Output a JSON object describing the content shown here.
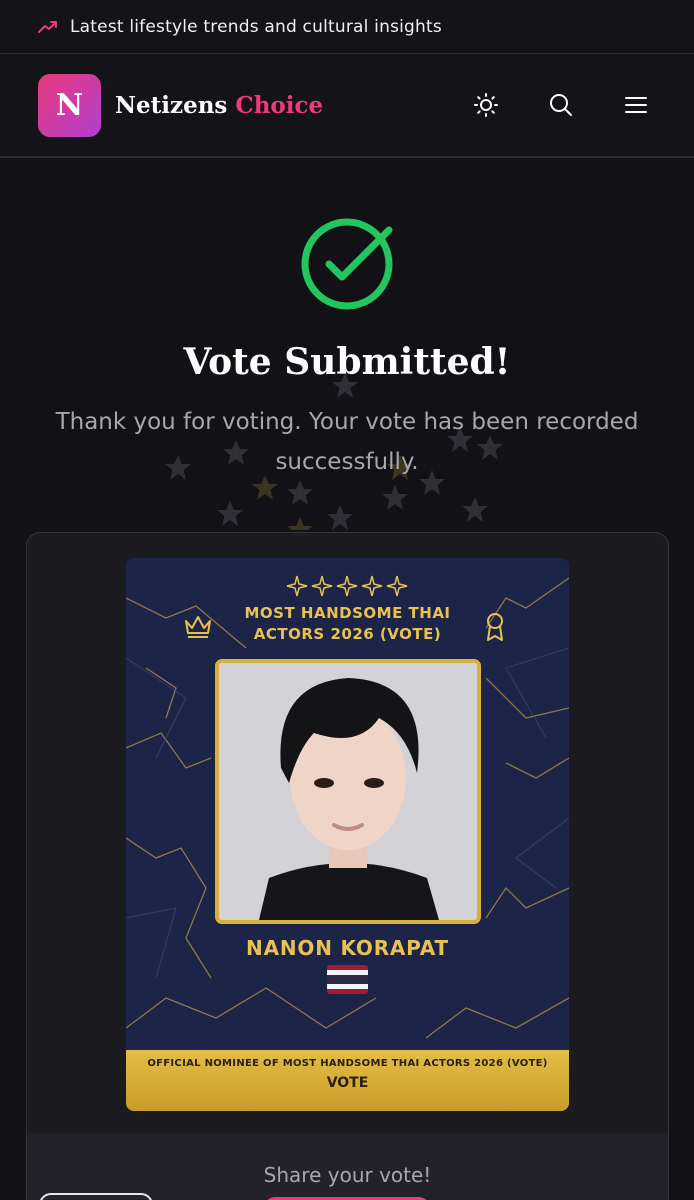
{
  "topbar": {
    "tagline": "Latest lifestyle trends and cultural insights",
    "icon": "trending-up-icon"
  },
  "header": {
    "logo_letter": "N",
    "brand_part1": "Netizens",
    "brand_part2": "Choice",
    "icons": [
      "theme-toggle-icon",
      "search-icon",
      "menu-icon"
    ]
  },
  "status": {
    "title": "Vote Submitted!",
    "message": "Thank you for voting. Your vote has been recorded successfully."
  },
  "card": {
    "title": "MOST HANDSOME THAI ACTORS 2026 (VOTE)",
    "nominee_name": "NANON KORAPAT",
    "country_flag": "thailand-flag-icon",
    "footer_line": "OFFICIAL NOMINEE OF MOST HANDSOME THAI ACTORS 2026 (VOTE)",
    "footer_vote": "VOTE"
  },
  "share": {
    "label": "Share your vote!"
  },
  "colors": {
    "accent": "#ee3b77",
    "success": "#22c55e",
    "gold": "#e8c250",
    "navy": "#1c2547"
  }
}
